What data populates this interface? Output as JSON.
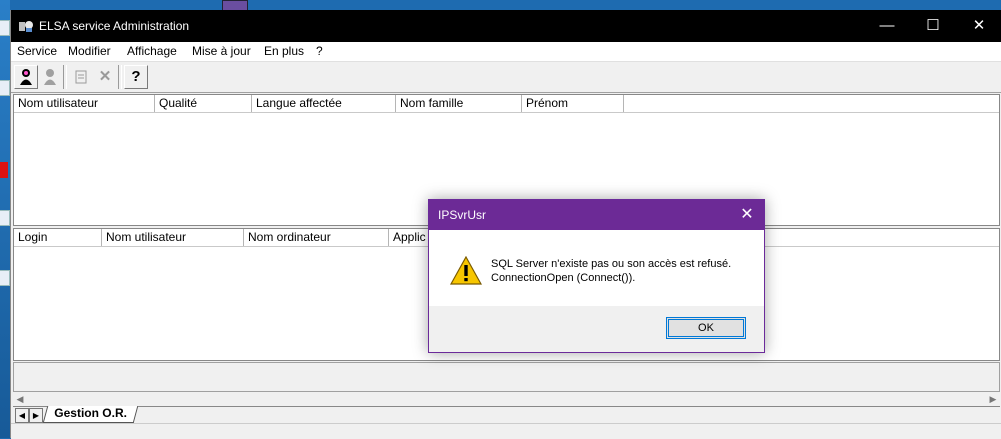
{
  "window": {
    "title": "ELSA service Administration",
    "minimize": "—",
    "maximize": "☐",
    "close": "✕"
  },
  "menu": [
    "Service",
    "Modifier",
    "Affichage",
    "Mise à jour",
    "En plus",
    "?"
  ],
  "toolbar": {
    "help_glyph": "?",
    "delete_glyph": "✕"
  },
  "table_users": {
    "columns": [
      "Nom utilisateur",
      "Qualité",
      "Langue affectée",
      "Nom famille",
      "Prénom"
    ]
  },
  "table_sessions": {
    "columns": [
      "Login",
      "Nom utilisateur",
      "Nom ordinateur",
      "Applic"
    ]
  },
  "tabs": [
    "Gestion O.R."
  ],
  "scroll": {
    "left": "◀",
    "right": "▶"
  },
  "tabnav": {
    "prev": "◀",
    "next": "▶"
  },
  "dialog": {
    "title": "IPSvrUsr",
    "close": "✕",
    "message_line1": "SQL Server n'existe pas ou son accès est refusé.",
    "message_line2": "ConnectionOpen (Connect()).",
    "ok_label": "OK"
  },
  "colors": {
    "dialog_title_bg": "#6c2a96",
    "titlebar_bg": "#000000",
    "ok_focus": "#0078d7"
  }
}
